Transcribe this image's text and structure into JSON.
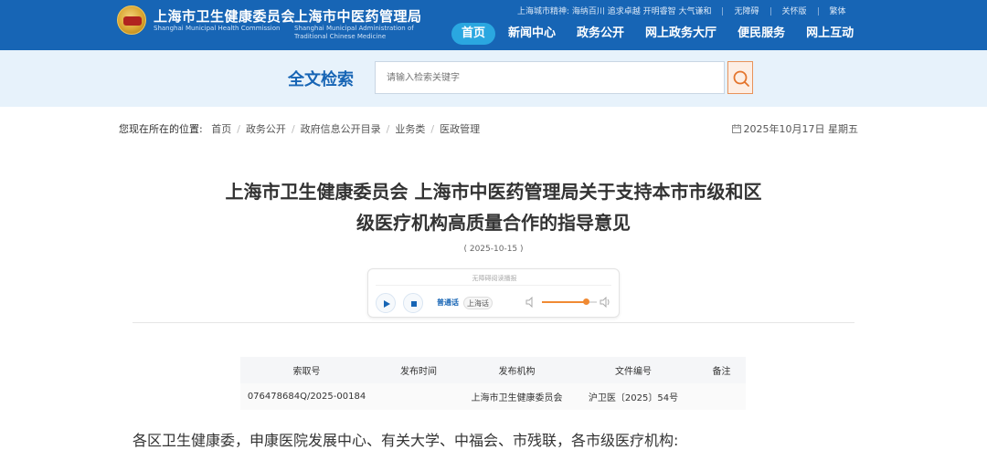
{
  "header": {
    "org1_name": "上海市卫生健康委员会",
    "org1_en": "Shanghai Municipal Health Commission",
    "org2_name": "上海市中医药管理局",
    "org2_en": "Shanghai Municipal Administration of Traditional Chinese Medicine",
    "top_links": [
      "上海城市精神: 海纳百川 追求卓越 开明睿智 大气谦和",
      "无障碍",
      "关怀版",
      "繁体"
    ],
    "nav": [
      {
        "label": "首页",
        "active": true
      },
      {
        "label": "新闻中心",
        "active": false
      },
      {
        "label": "政务公开",
        "active": false
      },
      {
        "label": "网上政务大厅",
        "active": false
      },
      {
        "label": "便民服务",
        "active": false
      },
      {
        "label": "网上互动",
        "active": false
      }
    ]
  },
  "search": {
    "title": "全文检索",
    "placeholder": "请输入检索关键字"
  },
  "breadcrumb": {
    "prefix": "您现在所在的位置:",
    "items": [
      "首页",
      "政务公开",
      "政府信息公开目录",
      "业务类",
      "医政管理"
    ]
  },
  "date": "2025年10月17日 星期五",
  "article": {
    "title_line1": "上海市卫生健康委员会 上海市中医药管理局关于支持本市市级和区",
    "title_line2": "级医疗机构高质量合作的指导意见",
    "pub_date": "( 2025-10-15 )"
  },
  "player": {
    "caption": "无障碍阅读播报",
    "lang_mandarin": "普通话",
    "lang_shanghainese": "上海话",
    "volume": 0.8
  },
  "meta_table": {
    "headers": [
      "索取号",
      "发布时间",
      "发布机构",
      "文件编号",
      "备注"
    ],
    "values": [
      "076478684Q/2025-00184",
      "",
      "上海市卫生健康委员会",
      "沪卫医〔2025〕54号",
      ""
    ]
  },
  "body_first_line": "各区卫生健康委，申康医院发展中心、有关大学、中福会、市残联，各市级医疗机构:"
}
